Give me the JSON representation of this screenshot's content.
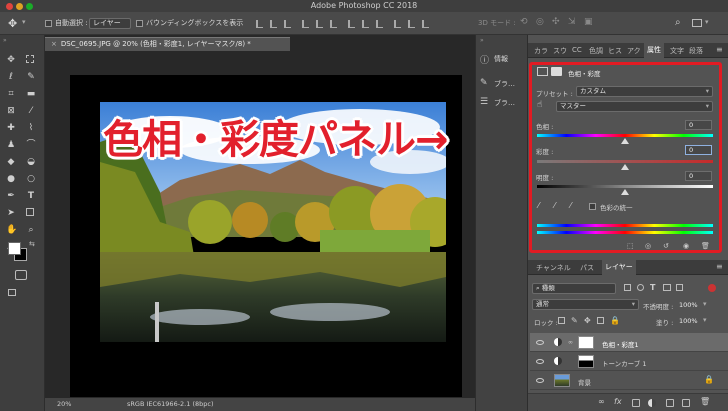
{
  "app": {
    "title": "Adobe Photoshop CC 2018"
  },
  "options": {
    "auto_select_label": "自動選択 :",
    "auto_select_value": "レイヤー",
    "bounding_box_label": "バウンディングボックスを表示",
    "mode3d_label": "3D モード :"
  },
  "document": {
    "tab_title": "DSC_0695.JPG @ 20% (色相・彩度1, レイヤーマスク/8) *",
    "zoom": "20%",
    "color_profile": "sRGB IEC61966-2.1 (8bpc)"
  },
  "annotation": {
    "text": "色相・彩度パネル→"
  },
  "collapsed_panels": {
    "info": "情報",
    "brush1": "ブラ…",
    "brush2": "ブラ…"
  },
  "properties": {
    "tabs": [
      "カラ",
      "スウ",
      "CC",
      "色調",
      "ヒス",
      "アク",
      "属性",
      "文字",
      "段落"
    ],
    "active_tab": "属性",
    "panel_title": "色相・彩度",
    "preset_label": "プリセット :",
    "preset_value": "カスタム",
    "channel_value": "マスター",
    "hue_label": "色相 :",
    "hue_value": "0",
    "saturation_label": "彩度 :",
    "saturation_value": "0",
    "lightness_label": "明度 :",
    "lightness_value": "0",
    "colorize_label": "色彩の統一",
    "hue_level": 0.5,
    "saturation_level": 0.5,
    "lightness_level": 0.5
  },
  "layers_panel": {
    "tabs": [
      "チャンネル",
      "パス",
      "レイヤー"
    ],
    "active_tab": "レイヤー",
    "filter_value": "種類",
    "blend_mode": "通常",
    "opacity_label": "不透明度 :",
    "opacity_value": "100%",
    "lock_label": "ロック :",
    "fill_label": "塗り :",
    "fill_value": "100%",
    "layers": [
      {
        "name": "色相・彩度1",
        "kind": "adjustment-hue"
      },
      {
        "name": "トーンカーブ 1",
        "kind": "adjustment-curves"
      },
      {
        "name": "背景",
        "kind": "image"
      }
    ]
  },
  "colors": {
    "accent_red": "#e2202c",
    "highlight_box": "#e21b23"
  }
}
